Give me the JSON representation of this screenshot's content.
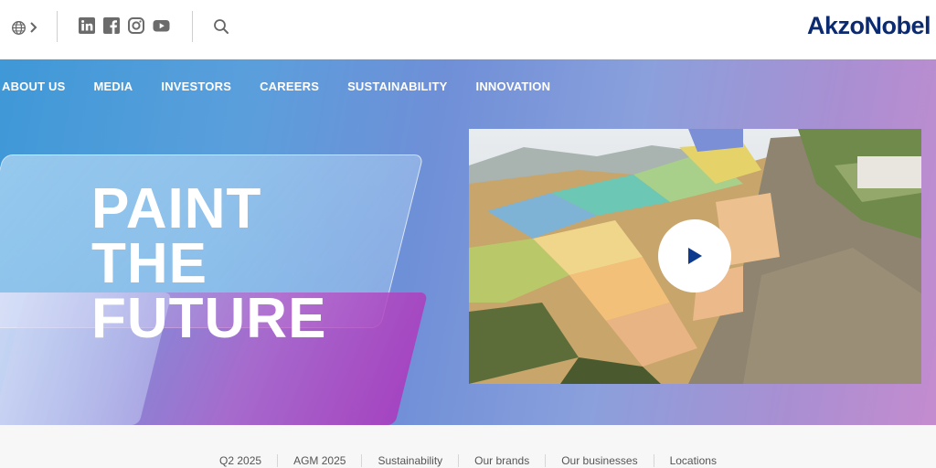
{
  "header": {
    "logo_text": "AkzoNobel",
    "icons": [
      "globe-icon",
      "chevron-right-icon",
      "linkedin-icon",
      "facebook-icon",
      "instagram-icon",
      "youtube-icon",
      "search-icon"
    ]
  },
  "nav": {
    "items": [
      {
        "label": "ABOUT US"
      },
      {
        "label": "MEDIA"
      },
      {
        "label": "INVESTORS"
      },
      {
        "label": "CAREERS"
      },
      {
        "label": "SUSTAINABILITY"
      },
      {
        "label": "INNOVATION"
      }
    ]
  },
  "hero": {
    "headline": [
      "PAINT",
      "THE",
      "FUTURE"
    ],
    "video_icon": "play-icon"
  },
  "footer": {
    "links": [
      {
        "label": "Q2 2025"
      },
      {
        "label": "AGM 2025"
      },
      {
        "label": "Sustainability"
      },
      {
        "label": "Our brands"
      },
      {
        "label": "Our businesses"
      },
      {
        "label": "Locations"
      }
    ]
  },
  "colors": {
    "brand": "#0b2a6f",
    "hero_start": "#3f98d7",
    "hero_end": "#c48ccf",
    "accent_magenta": "#b040c0",
    "play_triangle": "#0b3a8f"
  }
}
